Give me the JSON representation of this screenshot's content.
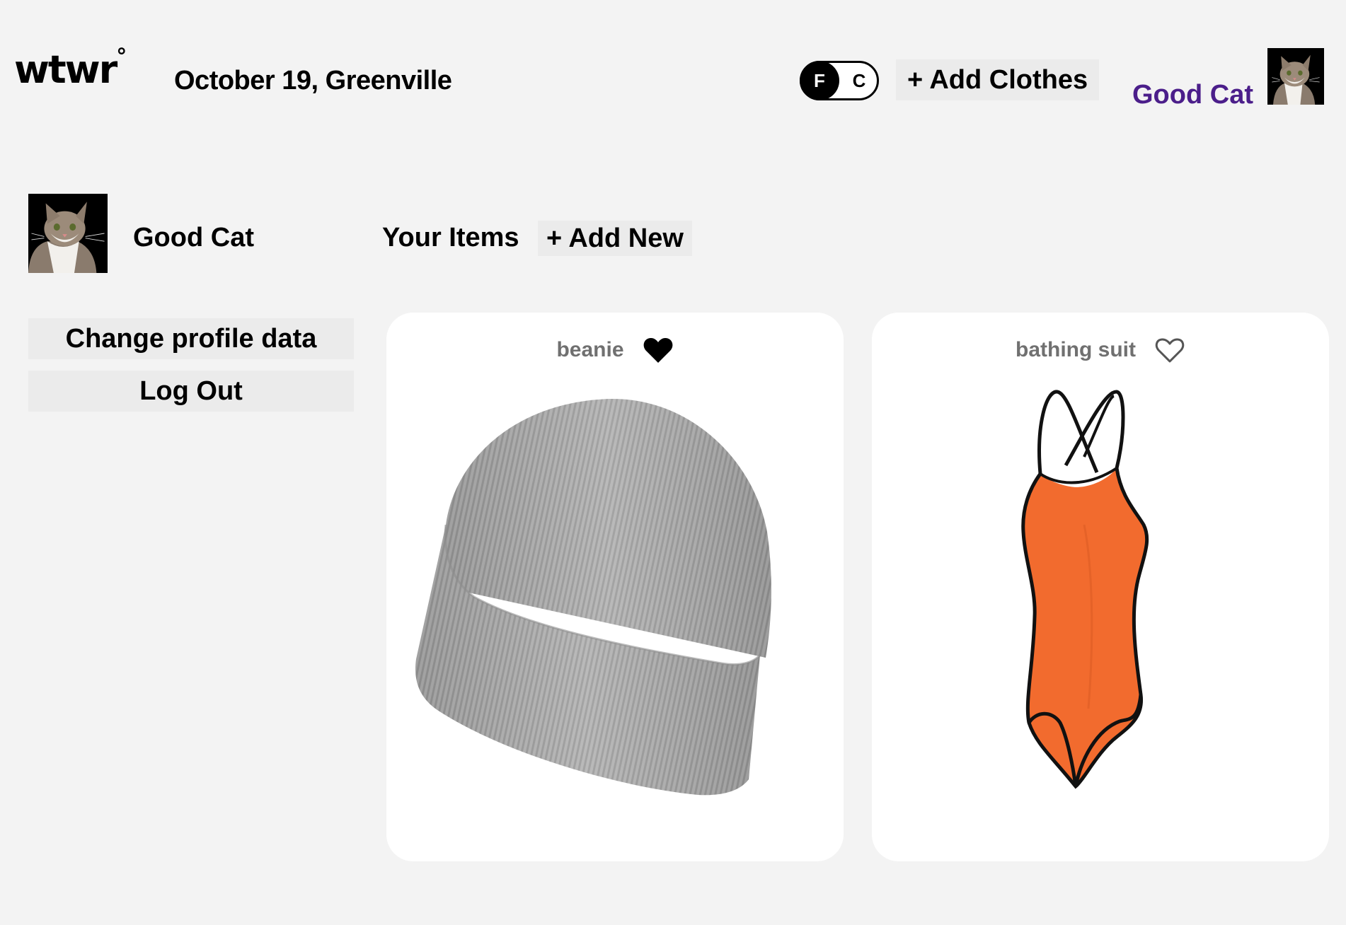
{
  "header": {
    "logo": "wtwr",
    "logo_mark": "°",
    "date_location": "October 19, Greenville",
    "temp_toggle": {
      "f_label": "F",
      "c_label": "C",
      "selected": "F"
    },
    "add_clothes_label": "+ Add Clothes",
    "username": "Good Cat",
    "avatar_icon": "cat-avatar-icon"
  },
  "sidebar": {
    "avatar_icon": "cat-avatar-icon",
    "username": "Good Cat",
    "change_profile_label": "Change profile data",
    "logout_label": "Log Out"
  },
  "items_section": {
    "title": "Your Items",
    "add_new_label": "+ Add New",
    "items": [
      {
        "name": "beanie",
        "liked": true,
        "icon": "beanie-image"
      },
      {
        "name": "bathing suit",
        "liked": false,
        "icon": "bathing-suit-image"
      }
    ]
  },
  "colors": {
    "background": "#f3f3f3",
    "username_accent": "#4b1e8a",
    "button_bg": "#ebebeb",
    "card_bg": "#ffffff",
    "item_name": "#707070",
    "swimsuit_orange": "#f26b2e",
    "beanie_gray": "#a8a8a8"
  }
}
